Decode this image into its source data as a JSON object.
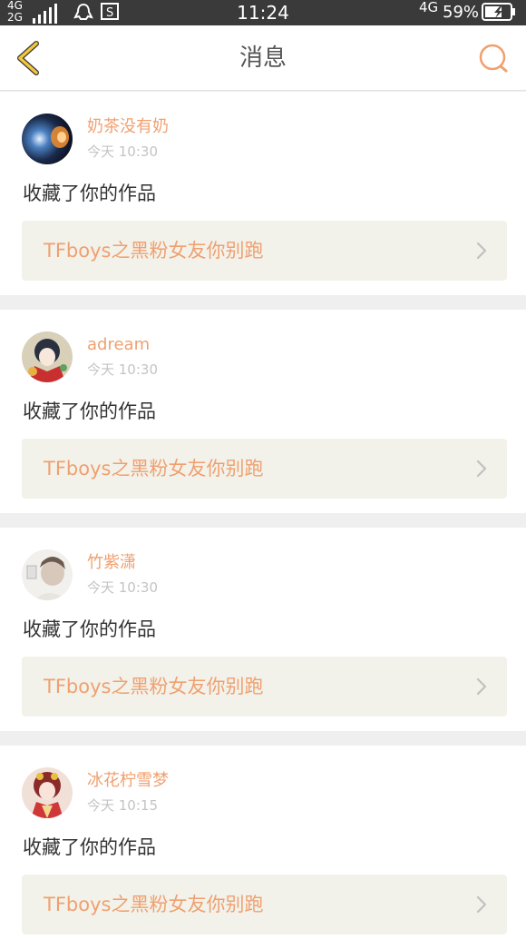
{
  "status_bar": {
    "net_top": "4G",
    "net_bottom": "2G",
    "time": "11:24",
    "net_right": "4G",
    "battery": "59%"
  },
  "header": {
    "title": "消息",
    "back_icon": "chevron-left-icon",
    "search_icon": "search-icon"
  },
  "colors": {
    "accent": "#f0a070",
    "back_icon": "#f3c63c",
    "card_link_bg": "#f2f2ea"
  },
  "messages": [
    {
      "username": "奶茶没有奶",
      "time": "今天 10:30",
      "action": "收藏了你的作品",
      "work_title": "TFboys之黑粉女友你别跑"
    },
    {
      "username": "adream",
      "time": "今天 10:30",
      "action": "收藏了你的作品",
      "work_title": "TFboys之黑粉女友你别跑"
    },
    {
      "username": "竹紫潇",
      "time": "今天 10:30",
      "action": "收藏了你的作品",
      "work_title": "TFboys之黑粉女友你别跑"
    },
    {
      "username": "冰花柠雪梦",
      "time": "今天 10:15",
      "action": "收藏了你的作品",
      "work_title": "TFboys之黑粉女友你别跑"
    }
  ]
}
